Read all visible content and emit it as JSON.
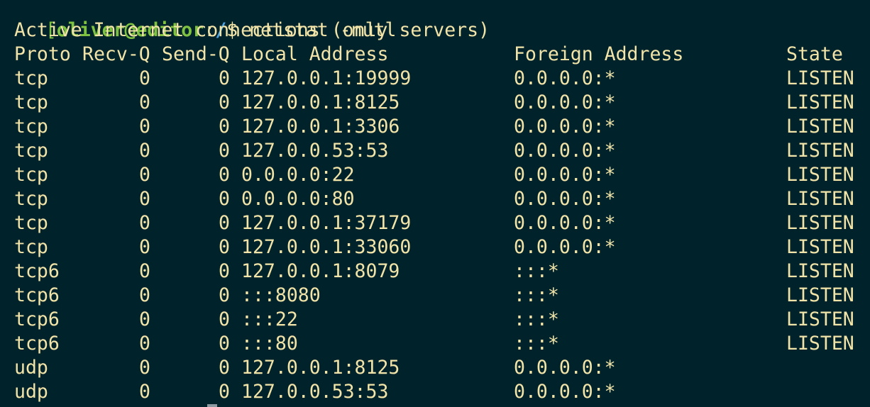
{
  "prompt": {
    "bracket": "[",
    "user_host": "oliver@editor",
    "colon": ":",
    "path": "/",
    "dollar": "$ ",
    "command": "netstat -nutl"
  },
  "title": "Active Internet connections (only servers)",
  "headers": {
    "proto": "Proto",
    "recvq": "Recv-Q",
    "sendq": "Send-Q",
    "local": "Local Address",
    "foreign": "Foreign Address",
    "state": "State"
  },
  "rows": [
    {
      "proto": "tcp",
      "recvq": "0",
      "sendq": "0",
      "local": "127.0.0.1:19999",
      "foreign": "0.0.0.0:*",
      "state": "LISTEN"
    },
    {
      "proto": "tcp",
      "recvq": "0",
      "sendq": "0",
      "local": "127.0.0.1:8125",
      "foreign": "0.0.0.0:*",
      "state": "LISTEN"
    },
    {
      "proto": "tcp",
      "recvq": "0",
      "sendq": "0",
      "local": "127.0.0.1:3306",
      "foreign": "0.0.0.0:*",
      "state": "LISTEN"
    },
    {
      "proto": "tcp",
      "recvq": "0",
      "sendq": "0",
      "local": "127.0.0.53:53",
      "foreign": "0.0.0.0:*",
      "state": "LISTEN"
    },
    {
      "proto": "tcp",
      "recvq": "0",
      "sendq": "0",
      "local": "0.0.0.0:22",
      "foreign": "0.0.0.0:*",
      "state": "LISTEN"
    },
    {
      "proto": "tcp",
      "recvq": "0",
      "sendq": "0",
      "local": "0.0.0.0:80",
      "foreign": "0.0.0.0:*",
      "state": "LISTEN"
    },
    {
      "proto": "tcp",
      "recvq": "0",
      "sendq": "0",
      "local": "127.0.0.1:37179",
      "foreign": "0.0.0.0:*",
      "state": "LISTEN"
    },
    {
      "proto": "tcp",
      "recvq": "0",
      "sendq": "0",
      "local": "127.0.0.1:33060",
      "foreign": "0.0.0.0:*",
      "state": "LISTEN"
    },
    {
      "proto": "tcp6",
      "recvq": "0",
      "sendq": "0",
      "local": "127.0.0.1:8079",
      "foreign": ":::*",
      "state": "LISTEN"
    },
    {
      "proto": "tcp6",
      "recvq": "0",
      "sendq": "0",
      "local": ":::8080",
      "foreign": ":::*",
      "state": "LISTEN"
    },
    {
      "proto": "tcp6",
      "recvq": "0",
      "sendq": "0",
      "local": ":::22",
      "foreign": ":::*",
      "state": "LISTEN"
    },
    {
      "proto": "tcp6",
      "recvq": "0",
      "sendq": "0",
      "local": ":::80",
      "foreign": ":::*",
      "state": "LISTEN"
    },
    {
      "proto": "udp",
      "recvq": "0",
      "sendq": "0",
      "local": "127.0.0.1:8125",
      "foreign": "0.0.0.0:*",
      "state": ""
    },
    {
      "proto": "udp",
      "recvq": "0",
      "sendq": "0",
      "local": "127.0.0.53:53",
      "foreign": "0.0.0.0:*",
      "state": ""
    }
  ],
  "colors": {
    "background": "#00222b",
    "text": "#f2e4a8",
    "prompt_user": "#7fc241",
    "prompt_path": "#4aa3e0"
  }
}
